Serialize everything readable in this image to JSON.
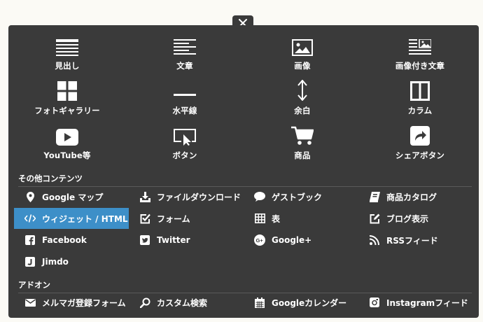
{
  "close_label": "×",
  "colors": {
    "panel": "#3a3a3a",
    "active": "#3d8fc8",
    "background": "#fbfaf5"
  },
  "tiles": [
    {
      "label": "見出し",
      "icon": "heading-icon"
    },
    {
      "label": "文章",
      "icon": "text-icon"
    },
    {
      "label": "画像",
      "icon": "image-icon"
    },
    {
      "label": "画像付き文章",
      "icon": "image-text-icon"
    },
    {
      "label": "フォトギャラリー",
      "icon": "gallery-icon"
    },
    {
      "label": "水平線",
      "icon": "horizontal-line-icon"
    },
    {
      "label": "余白",
      "icon": "spacing-icon"
    },
    {
      "label": "カラム",
      "icon": "columns-icon"
    },
    {
      "label": "YouTube等",
      "icon": "play-icon"
    },
    {
      "label": "ボタン",
      "icon": "button-cursor-icon"
    },
    {
      "label": "商品",
      "icon": "cart-icon"
    },
    {
      "label": "シェアボタン",
      "icon": "share-icon"
    }
  ],
  "other_section": {
    "title": "その他コンテンツ",
    "items": [
      {
        "label": "Google マップ",
        "icon": "map-pin-icon"
      },
      {
        "label": "ファイルダウンロード",
        "icon": "download-icon"
      },
      {
        "label": "ゲストブック",
        "icon": "speech-bubble-icon"
      },
      {
        "label": "商品カタログ",
        "icon": "catalog-book-icon"
      },
      {
        "label": "ウィジェット / HTML",
        "icon": "code-icon",
        "active": true
      },
      {
        "label": "フォーム",
        "icon": "checkbox-icon"
      },
      {
        "label": "表",
        "icon": "table-icon"
      },
      {
        "label": "ブログ表示",
        "icon": "edit-icon"
      },
      {
        "label": "Facebook",
        "icon": "facebook-icon"
      },
      {
        "label": "Twitter",
        "icon": "twitter-icon"
      },
      {
        "label": "Google+",
        "icon": "google-plus-icon"
      },
      {
        "label": "RSSフィード",
        "icon": "rss-icon"
      },
      {
        "label": "Jimdo",
        "icon": "jimdo-icon"
      }
    ]
  },
  "addon_section": {
    "title": "アドオン",
    "items": [
      {
        "label": "メルマガ登録フォーム",
        "icon": "mail-icon"
      },
      {
        "label": "カスタム検索",
        "icon": "search-icon"
      },
      {
        "label": "Googleカレンダー",
        "icon": "calendar-icon"
      },
      {
        "label": "Instagramフィード",
        "icon": "instagram-icon"
      }
    ]
  }
}
